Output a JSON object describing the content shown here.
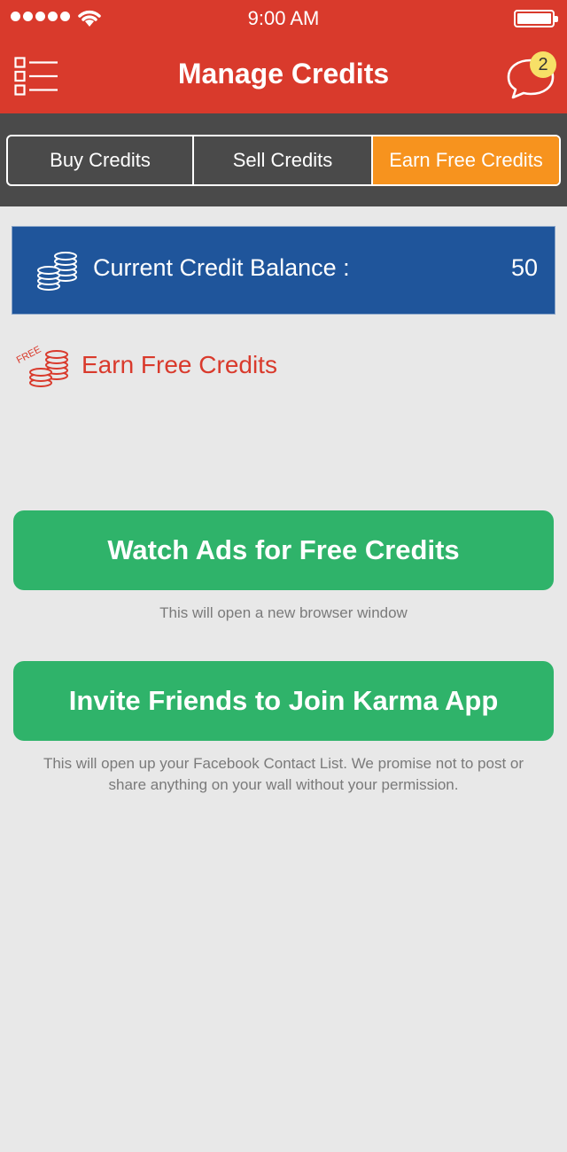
{
  "status_bar": {
    "time": "9:00 AM"
  },
  "header": {
    "title": "Manage Credits",
    "notification_count": "2"
  },
  "tabs": [
    {
      "label": "Buy Credits",
      "active": false
    },
    {
      "label": "Sell Credits",
      "active": false
    },
    {
      "label": "Earn Free Credits",
      "active": true
    }
  ],
  "balance": {
    "label": "Current Credit Balance :",
    "value": "50"
  },
  "earn": {
    "heading": "Earn Free Credits",
    "free_tag": "FREE"
  },
  "actions": [
    {
      "label": "Watch Ads for Free Credits",
      "note": "This will open a new browser window"
    },
    {
      "label": "Invite Friends to Join Karma App",
      "note": "This will open up your Facebook Contact List. We promise not to post or share anything on your wall without your permission."
    }
  ],
  "colors": {
    "header": "#d93a2c",
    "tab_active": "#f7931e",
    "balance_bg": "#1f559b",
    "button_green": "#2fb36a"
  },
  "icons": [
    "signal-dots-icon",
    "wifi-icon",
    "battery-icon",
    "menu-list-icon",
    "chat-bubble-icon",
    "coin-stack-icon",
    "free-coins-icon"
  ]
}
